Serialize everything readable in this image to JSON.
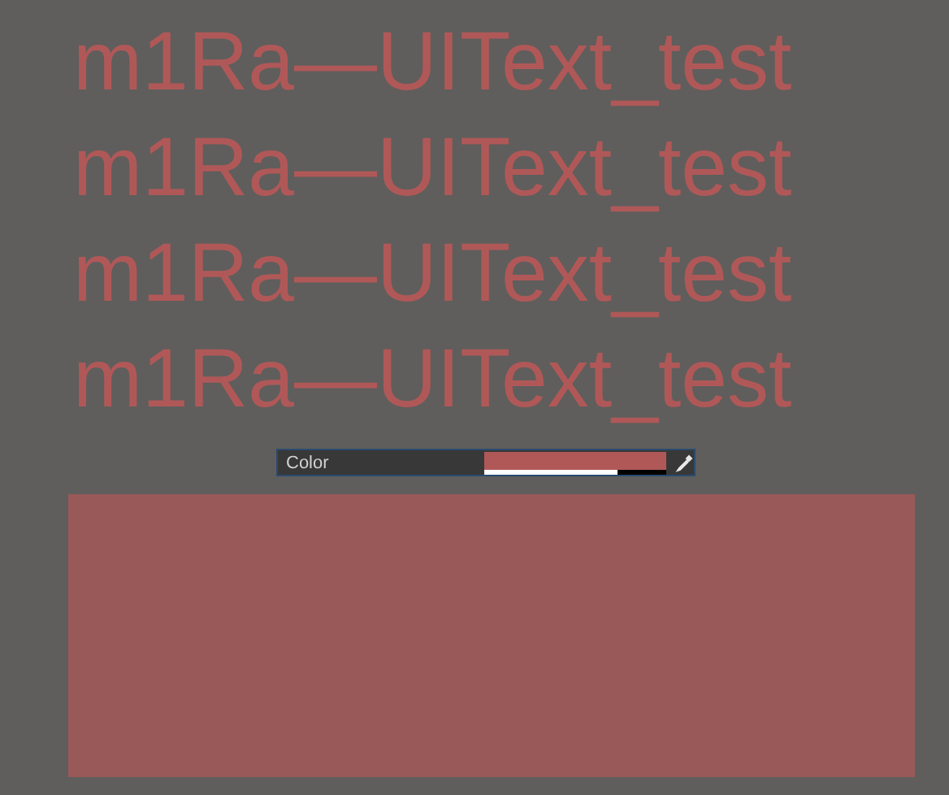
{
  "text_lines": [
    "m1Ra—UIText_test",
    "m1Ra—UIText_test",
    "m1Ra—UIText_test",
    "m1Ra—UIText_test"
  ],
  "color_field": {
    "label": "Color",
    "color": "#b05858",
    "level": 0.73
  }
}
